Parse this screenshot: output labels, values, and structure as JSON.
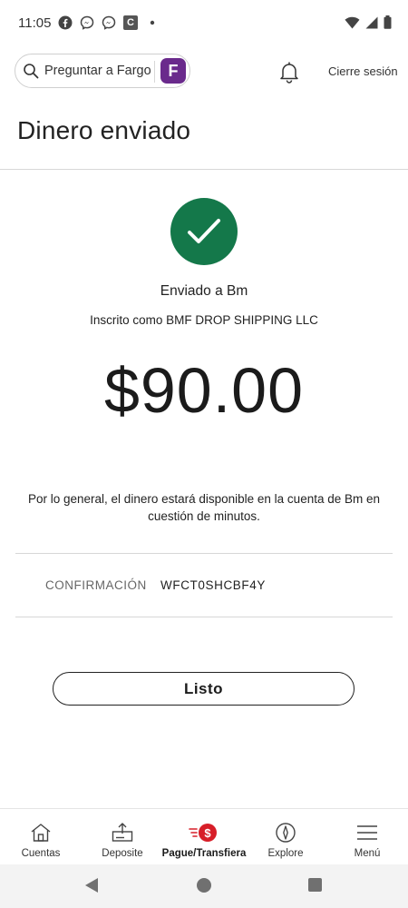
{
  "status_bar": {
    "time": "11:05",
    "left_icons": [
      "facebook-icon",
      "messenger-icon",
      "messenger-icon",
      "c-app-icon",
      "dot-icon"
    ],
    "c_app_letter": "C",
    "right_icons": [
      "wifi-icon",
      "signal-icon",
      "battery-icon"
    ]
  },
  "header": {
    "search_label": "Preguntar a Fargo",
    "fargo_badge_letter": "F",
    "logout_label": "Cierre sesión"
  },
  "page": {
    "title": "Dinero enviado"
  },
  "confirmation_card": {
    "sent_to": "Enviado a Bm",
    "enrolled_as": "Inscrito como BMF DROP SHIPPING LLC",
    "amount": "$90.00",
    "availability_note": "Por lo general, el dinero estará disponible en la cuenta de Bm en cuestión de minutos.",
    "confirmation_label": "CONFIRMACIÓN",
    "confirmation_value": "WFCT0SHCBF4Y"
  },
  "actions": {
    "done_label": "Listo"
  },
  "bottom_nav": {
    "items": [
      {
        "label": "Cuentas",
        "icon": "home-icon",
        "active": false
      },
      {
        "label": "Deposite",
        "icon": "deposit-icon",
        "active": false
      },
      {
        "label": "Pague/Transfiera",
        "icon": "pay-transfer-icon",
        "active": true
      },
      {
        "label": "Explore",
        "icon": "compass-icon",
        "active": false
      },
      {
        "label": "Menú",
        "icon": "menu-icon",
        "active": false
      }
    ],
    "pay_badge_symbol": "$"
  },
  "colors": {
    "success_green": "#14784a",
    "fargo_purple": "#6a2a8c",
    "active_red": "#d71e28",
    "text_dark": "#1d1d1d",
    "divider": "#d7d7d7"
  }
}
